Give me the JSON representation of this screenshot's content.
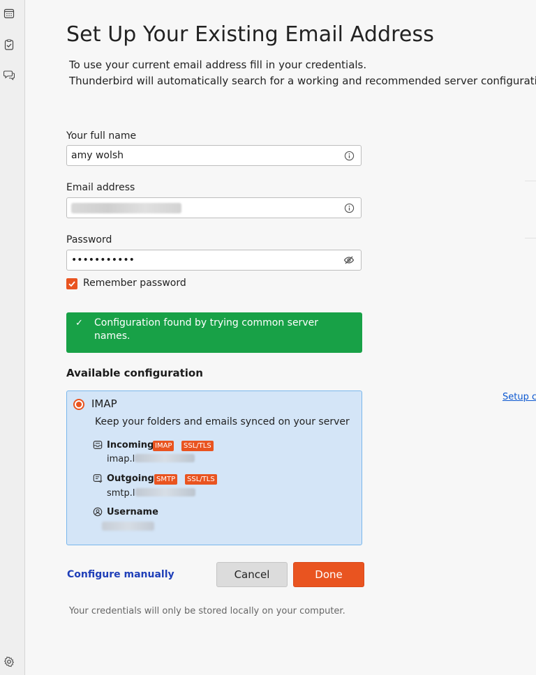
{
  "sidebar": {
    "icons": [
      "calendar-icon",
      "tasks-icon",
      "chat-icon",
      "settings-icon"
    ]
  },
  "header": {
    "title": "Set Up Your Existing Email Address",
    "subtitle_line1": "To use your current email address fill in your credentials.",
    "subtitle_line2": "Thunderbird will automatically search for a working and recommended server configuration."
  },
  "form": {
    "full_name_label": "Your full name",
    "full_name_value": "amy wolsh",
    "email_label": "Email address",
    "password_label": "Password",
    "password_value": "•••••••••••",
    "remember_password_label": "Remember password",
    "remember_password_checked": true
  },
  "status": {
    "message": "Configuration found by trying common server names.",
    "color": "#18a147"
  },
  "config": {
    "section_title": "Available configuration",
    "protocol": "IMAP",
    "description": "Keep your folders and emails synced on your server",
    "incoming_label": "Incoming",
    "incoming_badges": [
      "IMAP",
      "SSL/TLS"
    ],
    "incoming_host_prefix": "imap.l",
    "outgoing_label": "Outgoing",
    "outgoing_badges": [
      "SMTP",
      "SSL/TLS"
    ],
    "outgoing_host_prefix": "smtp.l",
    "username_label": "Username"
  },
  "side_link": "Setup c",
  "actions": {
    "configure_manually": "Configure manually",
    "cancel": "Cancel",
    "done": "Done"
  },
  "footnote": "Your credentials will only be stored locally on your computer.",
  "colors": {
    "accent": "#e95420",
    "success": "#18a147",
    "config_bg": "#d4e5f7",
    "config_border": "#79b6ec",
    "link": "#1f3fb8"
  }
}
